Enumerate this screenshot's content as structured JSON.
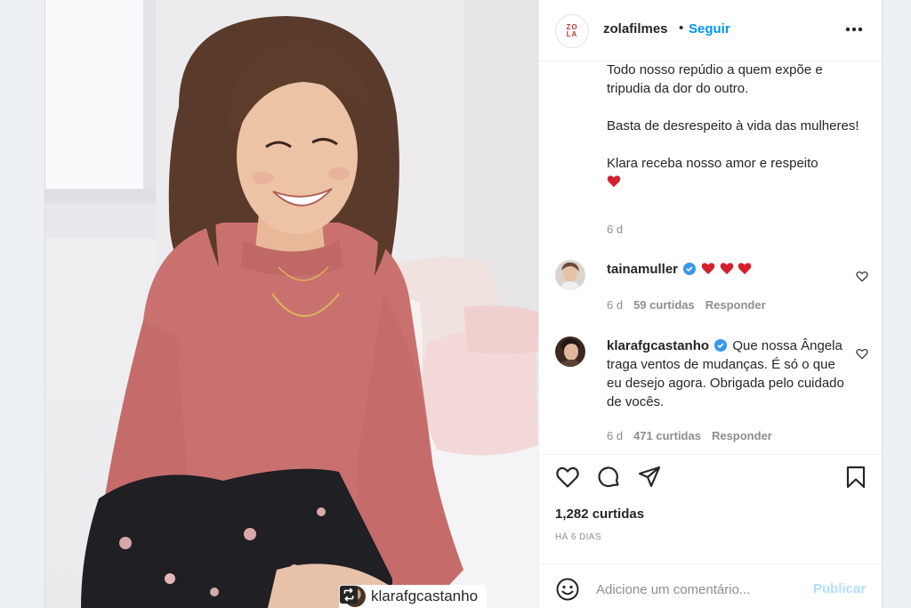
{
  "post": {
    "username": "zolafilmes",
    "follow_label": "Seguir",
    "header_separator": "•",
    "logo_text": [
      "ZO",
      "LA"
    ]
  },
  "image": {
    "repost_username": "klarafgcastanho"
  },
  "caption": {
    "lines_1": "Todo nosso repúdio a quem expõe e tripudia da dor do outro.",
    "lines_2": "Basta de desrespeito à vida das mulheres!",
    "lines_3": "Klara receba nosso amor e respeito",
    "time": "6 d"
  },
  "comments": [
    {
      "username": "tainamuller",
      "verified": true,
      "text": "",
      "hearts": 3,
      "time": "6 d",
      "likes": "59 curtidas",
      "reply": "Responder"
    },
    {
      "username": "klarafgcastanho",
      "verified": true,
      "text": "Que nossa Ângela traga ventos de mudanças. É só o que eu desejo agora. Obrigada pelo cuidado de vocês.",
      "time": "6 d",
      "likes": "471 curtidas",
      "reply": "Responder"
    }
  ],
  "stats": {
    "likes": "1,282 curtidas",
    "posted": "HÁ 6 DIAS"
  },
  "comment_box": {
    "placeholder": "Adicione um comentário...",
    "publish_label": "Publicar"
  },
  "colors": {
    "accent": "#0095f6",
    "publish_disabled": "#b2dffc",
    "secondary_text": "#8e8e8e",
    "heart_red": "#ed4956",
    "sweater": "#c9716f"
  },
  "icons": [
    "more-icon",
    "verified-icon",
    "heart-icon",
    "comment-icon",
    "share-icon",
    "bookmark-icon",
    "emoji-icon",
    "repost-icon"
  ]
}
